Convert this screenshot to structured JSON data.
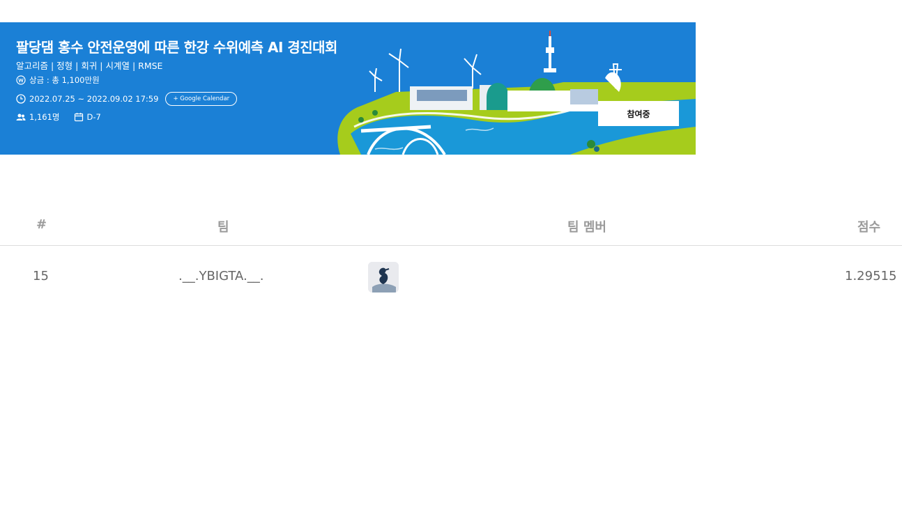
{
  "banner": {
    "title": "팔당댐 홍수 안전운영에 따른 한강 수위예측 AI 경진대회",
    "tags": "알고리즘 | 정형 | 회귀 | 시계열 | RMSE",
    "prize": "상금 : 총 1,100만원",
    "period": "2022.07.25 ~ 2022.09.02 17:59",
    "calendar_button": "+ Google Calendar",
    "participants": "1,161명",
    "dday": "D-7",
    "join_button": "참여중"
  },
  "leaderboard": {
    "headers": {
      "rank": "#",
      "team": "팀",
      "members": "팀 멤버",
      "score": "점수"
    },
    "rows": [
      {
        "rank": "15",
        "team": ".__.YBIGTA.__.",
        "score": "1.29515"
      }
    ]
  },
  "colors": {
    "banner_blue": "#1b80d6",
    "header_gray": "#9a9a9a",
    "land_green": "#a6cc1c",
    "river_blue": "#1a98d8"
  }
}
